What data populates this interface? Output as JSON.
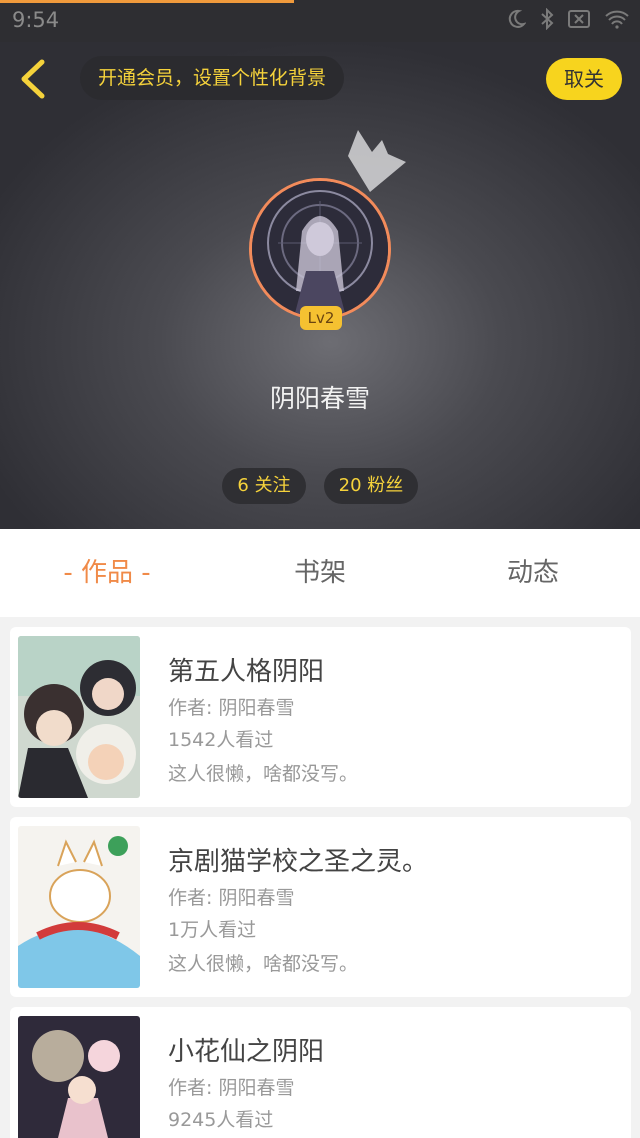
{
  "status_bar": {
    "time": "9:54",
    "icons": [
      "moon-icon",
      "bluetooth-icon",
      "no-sim-icon",
      "wifi-icon"
    ]
  },
  "header": {
    "vip_banner": "开通会员，设置个性化背景",
    "unfollow_label": "取关",
    "level": "Lv2",
    "username": "阴阳春雪",
    "following": "6 关注",
    "fans": "20 粉丝"
  },
  "tabs": [
    {
      "label": "- 作品 -",
      "active": true
    },
    {
      "label": "书架",
      "active": false
    },
    {
      "label": "动态",
      "active": false
    }
  ],
  "works": [
    {
      "title": "第五人格阴阳",
      "author": "作者: 阴阳春雪",
      "views": "1542人看过",
      "desc": "这人很懒，啥都没写。"
    },
    {
      "title": "京剧猫学校之圣之灵。",
      "author": "作者: 阴阳春雪",
      "views": "1万人看过",
      "desc": "这人很懒，啥都没写。"
    },
    {
      "title": "小花仙之阴阳",
      "author": "作者: 阴阳春雪",
      "views": "9245人看过",
      "desc": ""
    }
  ],
  "colors": {
    "accent_orange": "#f08a48",
    "accent_yellow": "#f7d41e",
    "header_dark": "#2f2f35"
  }
}
